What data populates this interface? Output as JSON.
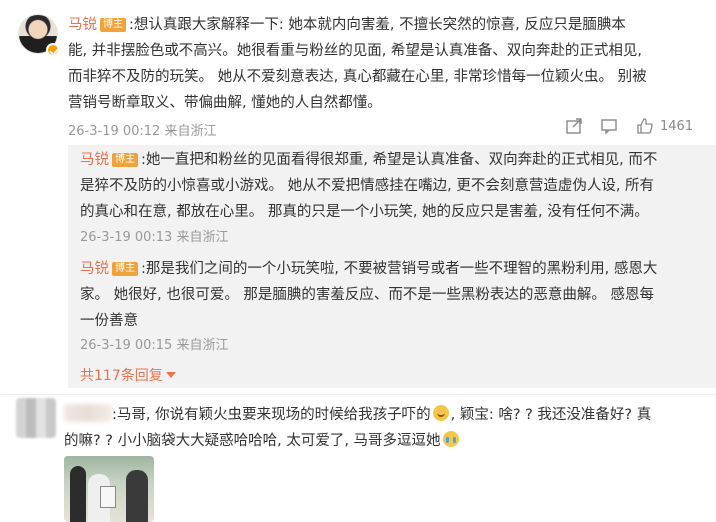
{
  "main_comment": {
    "author": "马锐",
    "badge": "博主",
    "lines": [
      ":想认真跟大家解释一下: 她本就内向害羞, 不擅长突然的惊喜, 反应只是腼腆本",
      "能, 并非摆脸色或不高兴。她很看重与粉丝的见面, 希望是认真准备、双向奔赴的正式相见,",
      "而非猝不及防的玩笑。 她从不爱刻意表达, 真心都藏在心里, 非常珍惜每一位颖火虫。 别被",
      "营销号断章取义、带偏曲解, 懂她的人自然都懂。"
    ],
    "timestamp": "26-3-19 00:12",
    "source": "来自浙江",
    "like_count": "1461"
  },
  "replies": [
    {
      "author": "马锐",
      "badge": "博主",
      "lines": [
        ":她一直把和粉丝的见面看得很郑重, 希望是认真准备、双向奔赴的正式相见, 而不",
        "是猝不及防的小惊喜或小游戏。 她从不爱把情感挂在嘴边, 更不会刻意营造虚伪人设, 所有",
        "的真心和在意, 都放在心里。 那真的只是一个小玩笑, 她的反应只是害羞, 没有任何不满。"
      ],
      "timestamp": "26-3-19 00:13",
      "source": "来自浙江"
    },
    {
      "author": "马锐",
      "badge": "博主",
      "lines": [
        ":那是我们之间的一个小玩笑啦, 不要被营销号或者一些不理智的黑粉利用, 感恩大",
        "家。 她很好, 也很可爱。 那是腼腆的害羞反应、而不是一些黑粉表达的恶意曲解。 感恩每",
        "一份善意"
      ],
      "timestamp": "26-3-19 00:15",
      "source": "来自浙江"
    }
  ],
  "more_replies_label": "共117条回复",
  "second_comment": {
    "line1_a": ":马哥, 你说有颖火虫要来现场的时候给我孩子吓的",
    "line1_b": ", 颖宝: 啥? ? 我还没准备好? 真",
    "line2": "的嘛? ? 小小脑袋大大疑惑哈哈哈, 太可爱了, 马哥多逗逗她"
  },
  "icons": {
    "share": "share-icon",
    "comment": "comment-icon",
    "like": "thumbs-up-icon"
  },
  "colors": {
    "name": "#eb7350",
    "badge": "#f0a33b",
    "meta": "#999999",
    "reply_bg": "#f2f2f2"
  }
}
